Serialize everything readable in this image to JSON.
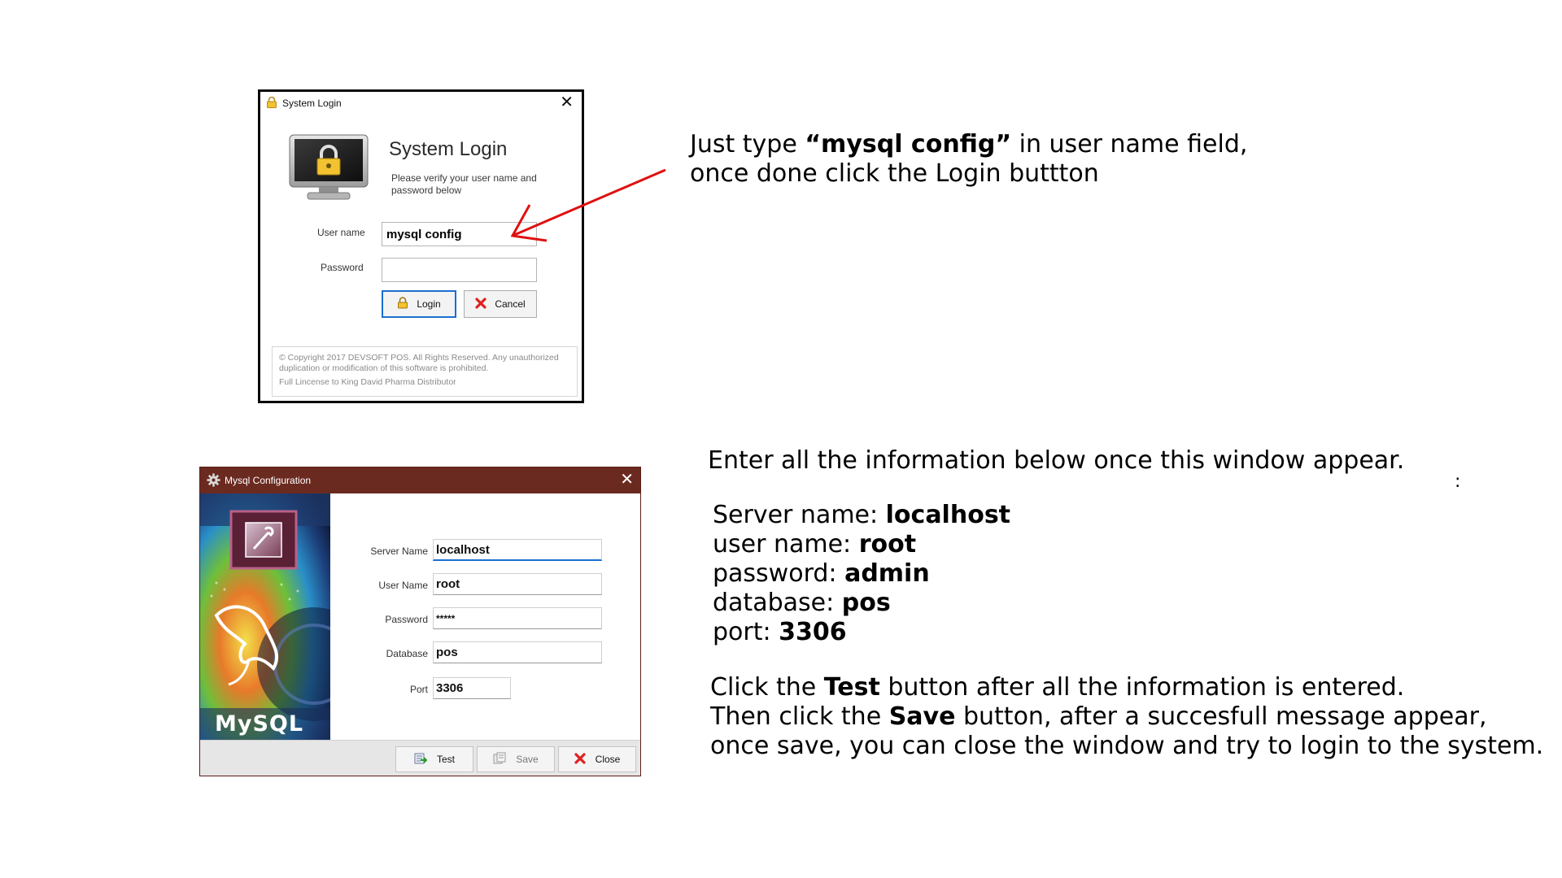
{
  "login": {
    "window_title": "System Login",
    "heading": "System Login",
    "subtitle": "Please verify your user name and password below",
    "username_label": "User name",
    "username_value": "mysql config",
    "password_label": "Password",
    "password_value": "",
    "login_button": "Login",
    "cancel_button": "Cancel",
    "copyright": "© Copyright 2017 DEVSOFT POS. All Rights Reserved. Any unauthorized duplication or modification of this software is prohibited.",
    "license": "Full Lincense to King David Pharma Distributor"
  },
  "mysql": {
    "window_title": "Mysql Configuration",
    "fields": {
      "server_name": {
        "label": "Server Name",
        "value": "localhost"
      },
      "user_name": {
        "label": "User Name",
        "value": "root"
      },
      "password": {
        "label": "Password",
        "value": "*****"
      },
      "database": {
        "label": "Database",
        "value": "pos"
      },
      "port": {
        "label": "Port",
        "value": "3306"
      }
    },
    "test_button": "Test",
    "save_button": "Save",
    "close_button": "Close",
    "logo_text": "MySQL"
  },
  "instructions": {
    "step1_a": "Just type ",
    "step1_b": "“mysql config”",
    "step1_c": " in user name field,",
    "step1_line2": "once done click the Login buttton",
    "step2": "Enter all the information below once this window appear.",
    "server_label": "Server name: ",
    "server_value": "localhost",
    "user_label": "user name: ",
    "user_value": "root",
    "pass_label": "password: ",
    "pass_value": "admin",
    "db_label": "database: ",
    "db_value": "pos",
    "port_label": "port: ",
    "port_value": "3306",
    "step3_a": "Click the ",
    "step3_b": "Test",
    "step3_c": " button after all the information is entered.",
    "step4_a": "Then click the ",
    "step4_b": "Save",
    "step4_c": " button, after a succesfull message appear,",
    "step5": "once save, you can close the window and try to login to the system.",
    "colon": ":"
  },
  "colors": {
    "arrow": "#e01010",
    "mysql_titlebar": "#6b2a20",
    "focus_blue": "#1a6fd0"
  }
}
